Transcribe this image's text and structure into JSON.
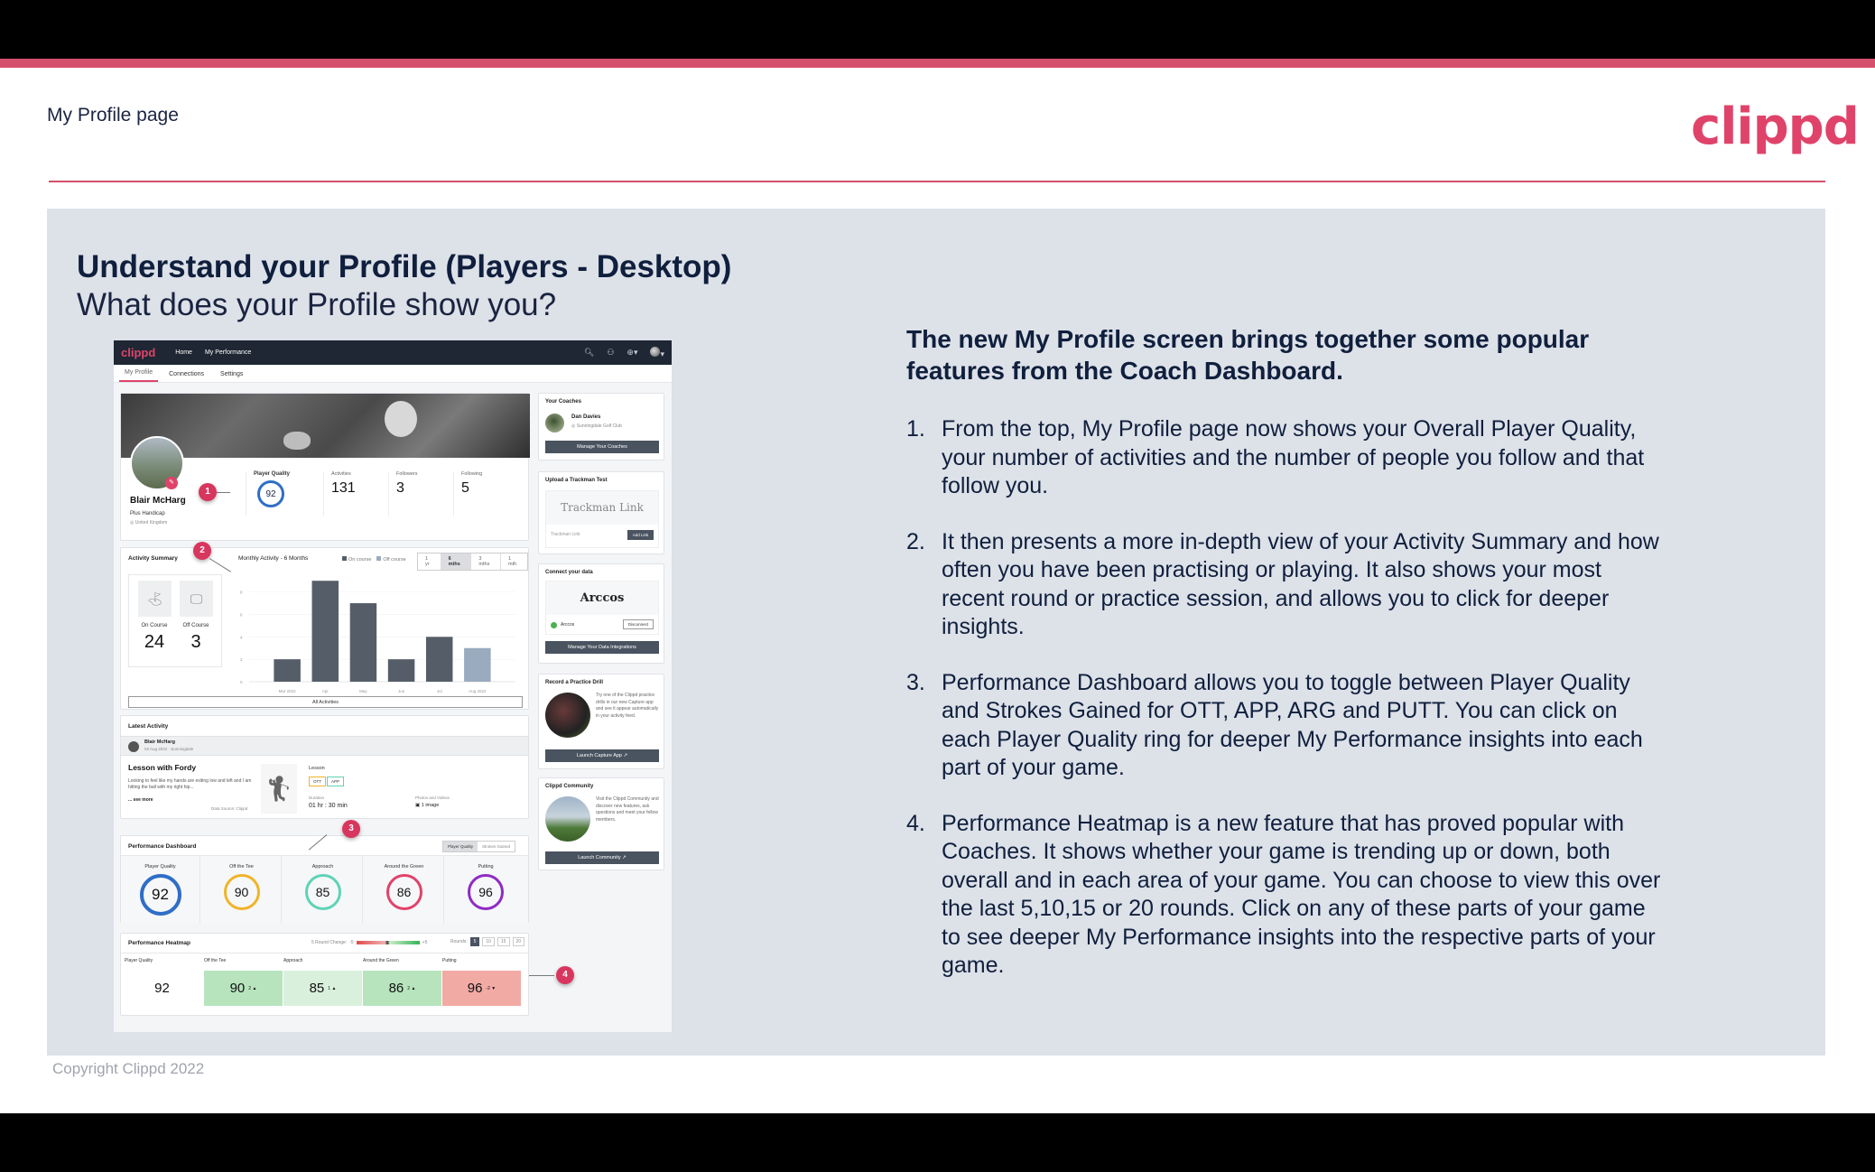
{
  "page": {
    "title": "My Profile page",
    "logo": "clippd",
    "heading": "Understand your Profile (Players - Desktop)",
    "subheading": "What does your Profile show you?",
    "copyright": "Copyright Clippd 2022",
    "brand_color": "#e0436a"
  },
  "explainer": {
    "lead": "The new My Profile screen brings together some popular features from the Coach Dashboard.",
    "items": [
      {
        "num": "1.",
        "text": "From the top, My Profile page now shows your Overall Player Quality, your number of activities and the number of people you follow and that follow you."
      },
      {
        "num": "2.",
        "text": "It then presents a more in-depth view of your Activity Summary and how often you have been practising or playing. It also shows your most recent round or practice session, and allows you to click for deeper insights."
      },
      {
        "num": "3.",
        "text": "Performance Dashboard allows you to toggle between Player Quality and Strokes Gained for OTT, APP, ARG and PUTT. You can click on each Player Quality ring for deeper My Performance insights into each part of your game."
      },
      {
        "num": "4.",
        "text": "Performance Heatmap is a new feature that has proved popular with Coaches. It shows whether your game is trending up or down, both overall and in each area of your game. You can choose to view this over the last 5,10,15 or 20 rounds. Click on any of these parts of your game to see deeper My Performance insights into the respective parts of your game."
      }
    ]
  },
  "app": {
    "nav": {
      "logo": "clippd",
      "links": [
        "Home",
        "My Performance"
      ],
      "icons": [
        "search-icon",
        "people-icon",
        "add-circle-icon",
        "user-avatar-icon"
      ]
    },
    "tabs": [
      {
        "label": "My Profile",
        "active": true
      },
      {
        "label": "Connections",
        "active": false
      },
      {
        "label": "Settings",
        "active": false
      }
    ],
    "profile": {
      "name": "Blair McHarg",
      "handicap": "Plus Handicap",
      "location": "United Kingdom",
      "player_quality_label": "Player Quality",
      "player_quality": "92",
      "stats": [
        {
          "label": "Activities",
          "value": "131"
        },
        {
          "label": "Followers",
          "value": "3"
        },
        {
          "label": "Following",
          "value": "5"
        }
      ]
    },
    "callouts": [
      "1",
      "2",
      "3",
      "4"
    ],
    "activity": {
      "title": "Activity Summary",
      "on_course_label": "On Course",
      "on_course": "24",
      "off_course_label": "Off Course",
      "off_course": "3",
      "chart_title": "Monthly Activity - 6 Months",
      "legend": [
        "On course",
        "Off course"
      ],
      "ranges": [
        {
          "label": "1 yr",
          "active": false
        },
        {
          "label": "6 mths",
          "active": true
        },
        {
          "label": "3 mths",
          "active": false
        },
        {
          "label": "1 mth",
          "active": false
        }
      ],
      "all_button": "All Activities"
    },
    "latest": {
      "title": "Latest Activity",
      "user": "Blair McHarg",
      "meta": "03 Aug 2022 · Sunningdale",
      "lesson_title": "Lesson with Fordy",
      "description": "Looking to feel like my hands are exiting low and left and I am hitting the ball with my right hip...",
      "see_more": "... see more",
      "source": "Data Source: Clippd",
      "type": "Lesson",
      "tags": [
        "OTT",
        "APP"
      ],
      "duration_label": "Duration",
      "duration": "01 hr : 30 min",
      "photos_label": "Photos and Videos",
      "photos": "1 image"
    },
    "performance": {
      "title": "Performance Dashboard",
      "toggle": [
        {
          "label": "Player Quality",
          "active": true
        },
        {
          "label": "Strokes Gained",
          "active": false
        }
      ],
      "rings": [
        {
          "label": "Player Quality",
          "value": "92",
          "color": "#2f6ec6"
        },
        {
          "label": "Off the Tee",
          "value": "90",
          "color": "#f0b429"
        },
        {
          "label": "Approach",
          "value": "85",
          "color": "#5fd3b5"
        },
        {
          "label": "Around the Green",
          "value": "86",
          "color": "#e0436a"
        },
        {
          "label": "Putting",
          "value": "96",
          "color": "#8e2bc4"
        }
      ]
    },
    "heatmap": {
      "title": "Performance Heatmap",
      "change_label": "5 Round Change:",
      "min_label": "-5",
      "max_label": "+5",
      "rounds_label": "Rounds:",
      "rounds": [
        {
          "label": "5",
          "active": true
        },
        {
          "label": "10",
          "active": false
        },
        {
          "label": "15",
          "active": false
        },
        {
          "label": "20",
          "active": false
        }
      ],
      "cells": [
        {
          "label": "Player Quality",
          "value": "92",
          "delta": "",
          "bg": "#ffffff"
        },
        {
          "label": "Off the Tee",
          "value": "90",
          "delta": "2 ▲",
          "bg": "#b7e4bd"
        },
        {
          "label": "Approach",
          "value": "85",
          "delta": "1 ▲",
          "bg": "#d9f0dc"
        },
        {
          "label": "Around the Green",
          "value": "86",
          "delta": "2 ▲",
          "bg": "#b7e4bd"
        },
        {
          "label": "Putting",
          "value": "96",
          "delta": "-2 ▼",
          "bg": "#f2aaa5"
        }
      ]
    },
    "sidebar": {
      "coaches": {
        "title": "Your Coaches",
        "name": "Dan Davies",
        "club": "Sunningdale Golf Club",
        "button": "Manage Your Coaches"
      },
      "trackman": {
        "title": "Upload a Trackman Test",
        "logo": "Trackman Link",
        "placeholder": "Trackman Link",
        "button": "Add Link"
      },
      "connect": {
        "title": "Connect your data",
        "logo": "Arccos",
        "provider": "Arccos",
        "disconnect": "Disconnect",
        "button": "Manage Your Data Integrations"
      },
      "drill": {
        "title": "Record a Practice Drill",
        "text": "Try one of the Clippd practice drills in our new Capture app and see it appear automatically in your activity feed.",
        "button": "Launch Capture App ↗"
      },
      "community": {
        "title": "Clippd Community",
        "text": "Visit the Clippd Community and discover new features, ask questions and meet your fellow members.",
        "button": "Launch Community ↗"
      }
    }
  },
  "chart_data": {
    "type": "bar",
    "title": "Monthly Activity - 6 Months",
    "categories": [
      "Mar 2022",
      "Apr",
      "May",
      "Jun",
      "Jul",
      "Aug 2022"
    ],
    "series": [
      {
        "name": "On course",
        "values": [
          2,
          9,
          7,
          2,
          4,
          0
        ],
        "color": "#555e68"
      },
      {
        "name": "Off course",
        "values": [
          0,
          0,
          0,
          0,
          0,
          3
        ],
        "color": "#9aaabf"
      }
    ],
    "yticks": [
      0,
      2,
      4,
      6,
      8
    ],
    "ylim": [
      0,
      9.5
    ],
    "xlabel": "",
    "ylabel": "",
    "grid": true,
    "legend": "top"
  }
}
